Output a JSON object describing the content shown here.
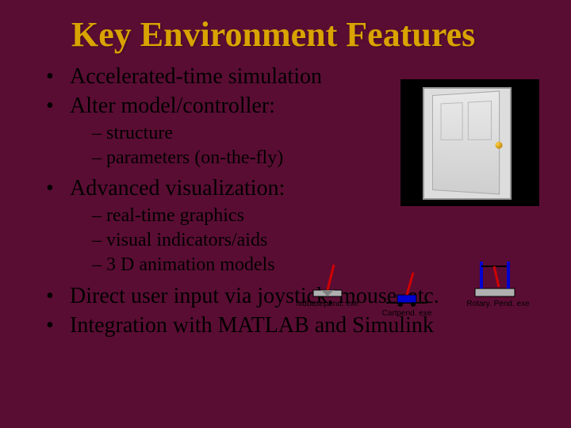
{
  "title": "Key Environment Features",
  "bullets": [
    {
      "text": "Accelerated-time simulation"
    },
    {
      "text": "Alter model/controller:",
      "sub": [
        "structure",
        "parameters (on-the-fly)"
      ]
    },
    {
      "text": "Advanced visualization:",
      "sub": [
        "real-time graphics",
        "visual indicators/aids",
        "3 D animation models"
      ]
    },
    {
      "text": "Direct user input via joystick, mouse, etc."
    },
    {
      "text": "Integration with MATLAB and Simulink"
    }
  ],
  "icons": {
    "fxdbase": {
      "caption": "fxdbasepend. exe"
    },
    "cart": {
      "caption": "Cartpend. exe"
    },
    "rotary": {
      "caption": "Rotary. Pend. exe"
    }
  }
}
